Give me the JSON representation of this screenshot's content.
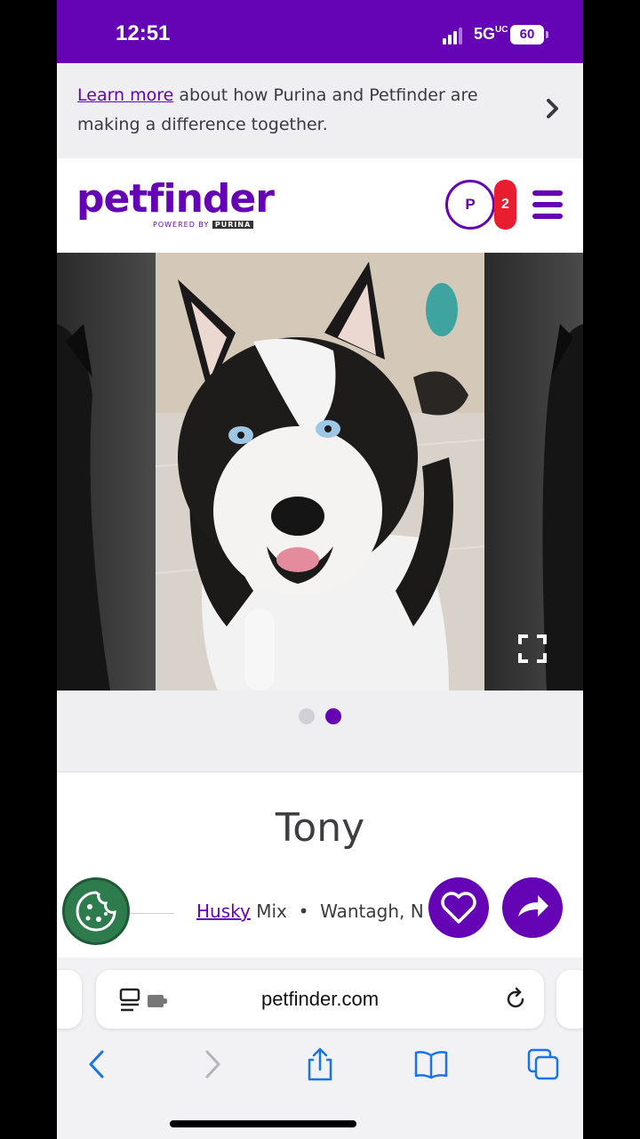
{
  "status_bar": {
    "time": "12:51",
    "network": "5G",
    "network_suffix": "UC",
    "battery": "60"
  },
  "banner": {
    "link_text": "Learn more",
    "text": " about how Purina and Petfinder are making a difference together."
  },
  "header": {
    "logo_text": "petfinder",
    "logo_sub": "POWERED BY",
    "logo_purina": "PURINA",
    "profile_initial": "P",
    "notification_count": "2"
  },
  "carousel": {
    "dots_total": 2,
    "active_dot_index": 1
  },
  "pet": {
    "name": "Tony",
    "breed": "Husky",
    "breed_suffix": " Mix",
    "separator": "•",
    "location": "Wantagh, N"
  },
  "browser": {
    "url": "petfinder.com"
  },
  "colors": {
    "brand": "#6504b5",
    "badge_red": "#e81e30",
    "cookie_green": "#2e7c4d"
  },
  "icons": [
    "chevron-right-icon",
    "menu-icon",
    "expand-icon",
    "cookie-icon",
    "heart-icon",
    "share-arrow-icon",
    "reader-icon",
    "extension-icon",
    "reload-icon",
    "back-icon",
    "forward-icon",
    "share-icon",
    "bookmarks-icon",
    "tabs-icon"
  ]
}
